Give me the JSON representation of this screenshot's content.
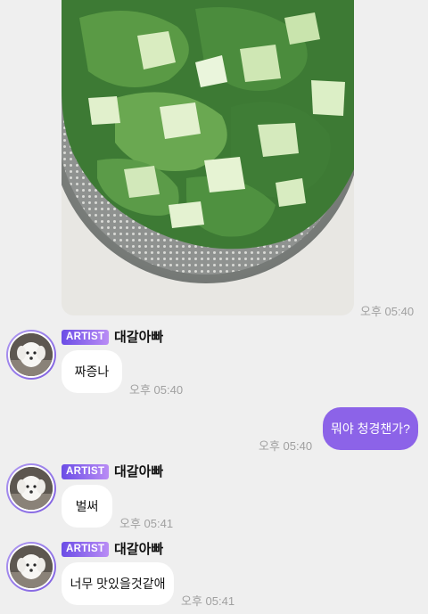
{
  "photo_message": {
    "image": "salad-greens-in-colander-photo",
    "time": "오후 05:40"
  },
  "messages": [
    {
      "sender": {
        "badge": "ARTIST",
        "name": "대갈아빠",
        "avatar": "white-dog-avatar"
      },
      "text": "짜증나",
      "time": "오후 05:40"
    },
    {
      "outgoing": true,
      "text": "뭐야 청경챈가?",
      "time": "오후 05:40"
    },
    {
      "sender": {
        "badge": "ARTIST",
        "name": "대갈아빠",
        "avatar": "white-dog-avatar"
      },
      "text": "벌써",
      "time": "오후 05:41"
    },
    {
      "sender": {
        "badge": "ARTIST",
        "name": "대갈아빠",
        "avatar": "white-dog-avatar"
      },
      "text": "너무 맛있을것같애",
      "time": "오후 05:41"
    }
  ],
  "colors": {
    "background": "#efefef",
    "outgoing_bubble": "#8c63e8",
    "incoming_bubble": "#ffffff",
    "badge_start": "#6b4de6",
    "badge_end": "#b98cf5",
    "timestamp": "#a0a0a0"
  }
}
